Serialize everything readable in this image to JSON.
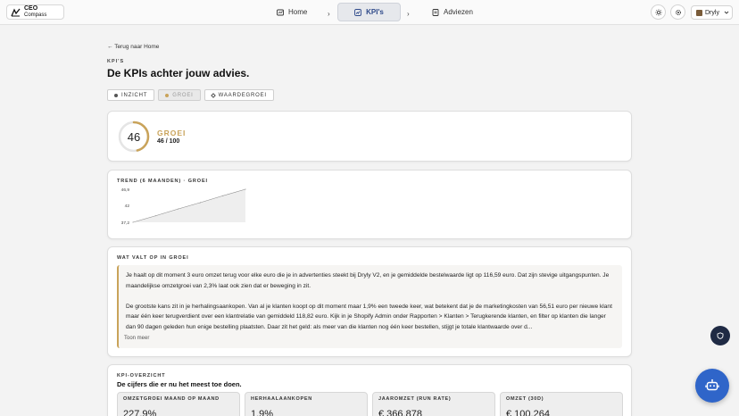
{
  "app": {
    "logo_line1": "CEO",
    "logo_line2": "Compass"
  },
  "nav": {
    "home": "Home",
    "kpis": "KPI's",
    "advice": "Adviezen",
    "separator": "›"
  },
  "header_actions": {
    "brand": "Dryly"
  },
  "page": {
    "back_link": "← Terug naar Home",
    "eyebrow": "KPI'S",
    "title": "De KPIs achter jouw advies.",
    "filters": [
      "INZICHT",
      "GROEI",
      "WAARDEGROEI"
    ],
    "active_filter": "GROEI"
  },
  "score": {
    "value": "46",
    "label": "GROEI",
    "fraction": "46 / 100",
    "progress": 0.46,
    "accent": "#c9a35a"
  },
  "trend": {
    "title": "TREND (6 MAANDEN) · GROEI",
    "y_ticks": [
      "46,9",
      "42",
      "37,2"
    ]
  },
  "chart_data": {
    "type": "line",
    "title": "TREND (6 MAANDEN) · GROEI",
    "xlabel": "",
    "ylabel": "",
    "x": [
      1,
      2,
      3,
      4,
      5,
      6
    ],
    "series": [
      {
        "values": [
          37.2,
          39.1,
          41.1,
          43.0,
          45.0,
          46.9
        ]
      }
    ],
    "ylim": [
      37.2,
      46.9
    ],
    "y_ticks": [
      46.9,
      42,
      37.2
    ],
    "grid": false
  },
  "insight": {
    "title": "WAT VALT OP IN GROEI",
    "paragraph1": "Je haalt op dit moment 3 euro omzet terug voor elke euro die je in advertenties steekt bij Dryly V2, en je gemiddelde bestelwaarde ligt op 116,59 euro. Dat zijn stevige uitgangspunten. Je maandelijkse omzetgroei van 2,3% laat ook zien dat er beweging in zit.",
    "paragraph2": "De grootste kans zit in je herhalingsaankopen. Van al je klanten koopt op dit moment maar 1,9% een tweede keer, wat betekent dat je de marketingkosten van 56,51 euro per nieuwe klant maar één keer terugverdient over een klantrelatie van gemiddeld 118,82 euro. Kijk in je Shopify Admin onder Rapporten > Klanten > Terugkerende klanten, en filter op klanten die langer dan 90 dagen geleden hun enige bestelling plaatsten. Daar zit het geld: als meer van die klanten nog één keer bestellen, stijgt je totale klantwaarde over d...",
    "more": "Toon meer"
  },
  "kpi_overview": {
    "title": "KPI-OVERZICHT",
    "subtitle": "De cijfers die er nu het meest toe doen.",
    "items": [
      {
        "label": "OMZETGROEI MAAND OP MAAND",
        "value": "227,9%"
      },
      {
        "label": "HERHAALAANKOPEN",
        "value": "1,9%"
      },
      {
        "label": "JAAROMZET (RUN RATE)",
        "value": "€ 366.878"
      },
      {
        "label": "OMZET (30D)",
        "value": "€ 100.264"
      }
    ]
  }
}
